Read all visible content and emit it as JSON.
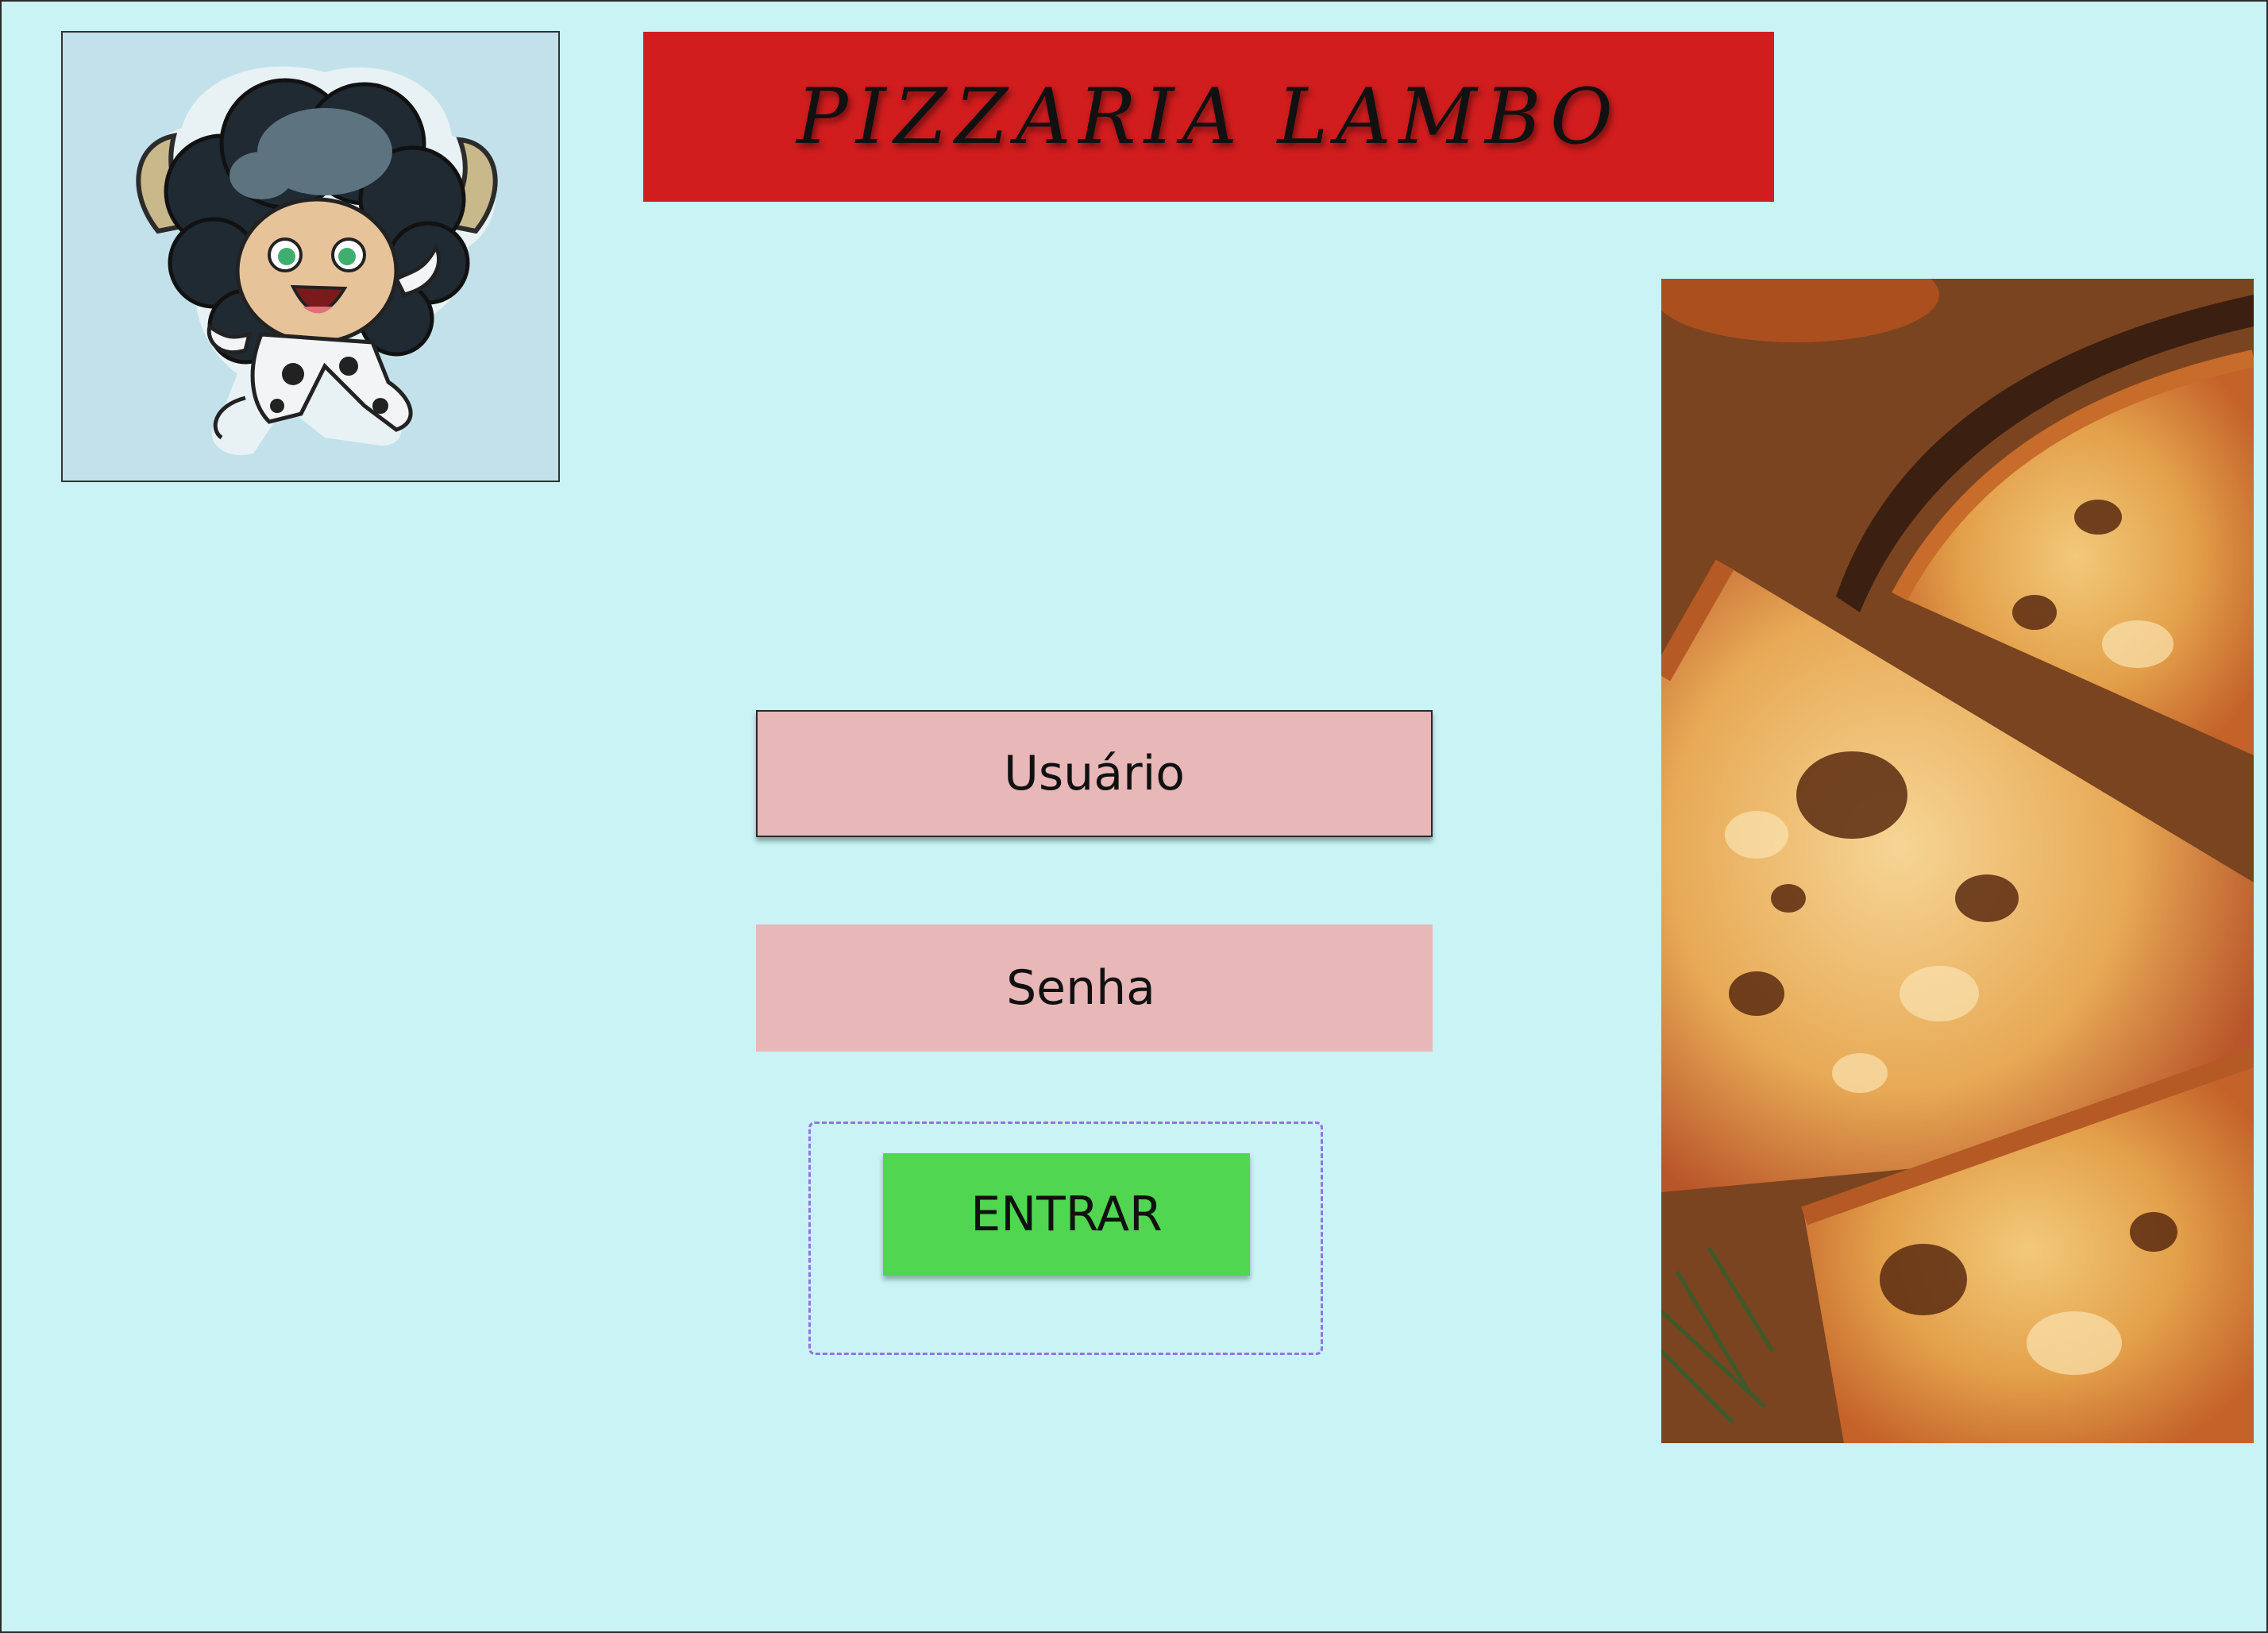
{
  "header": {
    "title": "PIZZARIA LAMBO"
  },
  "logo": {
    "icon": "cow-costume-character-icon"
  },
  "login": {
    "user_label": "Usuário",
    "password_label": "Senha",
    "submit_label": "ENTRAR"
  },
  "hero_image": {
    "icon": "pizza-photo"
  },
  "colors": {
    "background": "#c9f3f4",
    "banner": "#d11d1e",
    "field": "#e8b7b8",
    "button": "#50d651",
    "dashed_outline": "#9b6ee6"
  }
}
